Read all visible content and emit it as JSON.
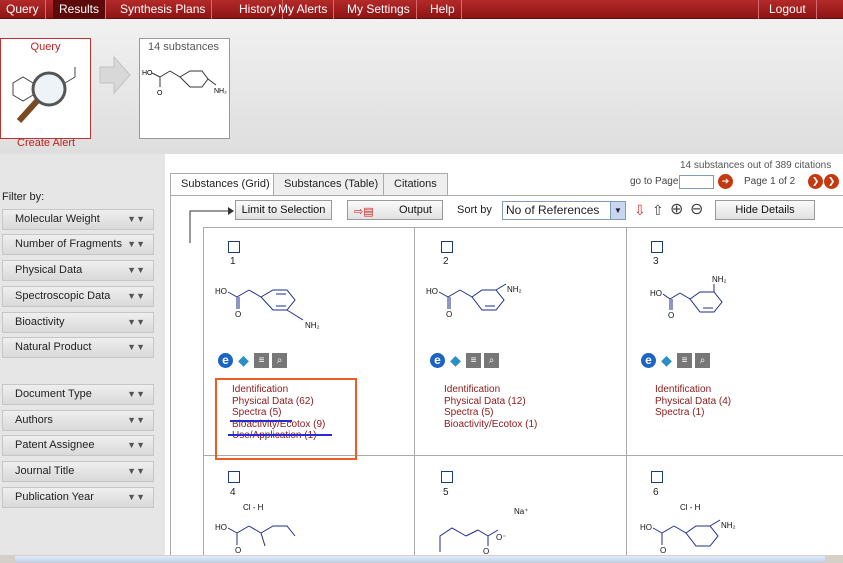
{
  "nav": {
    "items": [
      "Query",
      "Results",
      "Synthesis Plans",
      "History",
      "My Alerts",
      "My Settings",
      "Help"
    ],
    "logout": "Logout"
  },
  "header": {
    "query_label": "Query",
    "substances_label": "14 substances",
    "create_alert": "Create Alert"
  },
  "filters": {
    "title": "Filter by:",
    "group1": [
      "Molecular Weight",
      "Number of Fragments",
      "Physical Data",
      "Spectroscopic Data",
      "Bioactivity",
      "Natural Product"
    ],
    "group2": [
      "Document Type",
      "Authors",
      "Patent Assignee",
      "Journal Title",
      "Publication Year"
    ]
  },
  "results": {
    "status": "14 substances out of 389 citations",
    "goto_label": "go to Page",
    "page_of": "Page 1 of 2"
  },
  "tabs": [
    "Substances (Grid)",
    "Substances (Table)",
    "Citations"
  ],
  "toolbar": {
    "limit": "Limit to Selection",
    "output": "Output",
    "sort_label": "Sort by",
    "sort_value": "No of References",
    "hide_details": "Hide Details"
  },
  "cells": [
    {
      "num": "1",
      "links": [
        "Identification",
        "Physical Data (62)",
        "Spectra (5)",
        "Bioactivity/Ecotox (9)",
        "Use/Application (1)"
      ]
    },
    {
      "num": "2",
      "links": [
        "Identification",
        "Physical Data (12)",
        "Spectra (5)",
        "Bioactivity/Ecotox (1)"
      ]
    },
    {
      "num": "3",
      "links": [
        "Identification",
        "Physical Data (4)",
        "Spectra (1)"
      ]
    },
    {
      "num": "4",
      "salt": "Cl - H"
    },
    {
      "num": "5",
      "salt": "Na⁺"
    },
    {
      "num": "6",
      "salt": "Cl - H"
    }
  ],
  "chem": {
    "ho": "HO",
    "o": "O",
    "o_minus": "O⁻",
    "nh2": "NH₂"
  },
  "icons": {
    "e": "e",
    "d": "◆",
    "l": "≡",
    "m": "🔍",
    "down_arrow": "⇩",
    "up_arrow": "⇧",
    "zoom_in": "⊕",
    "zoom_out": "⊖",
    "next": "➔",
    "next_end": "❯"
  },
  "colors": {
    "nav": "#8e1414",
    "link": "#8b1a1a",
    "highlight": "#f05a24",
    "underline": "#2a2ad1"
  }
}
